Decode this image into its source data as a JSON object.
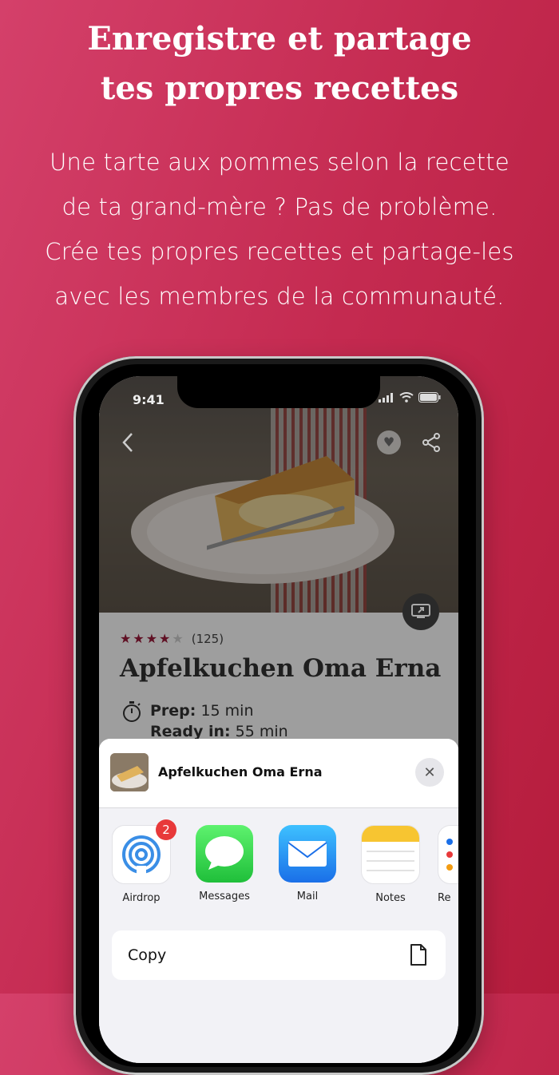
{
  "headline": {
    "line1": "Enregistre et partage",
    "line2": "tes propres recettes"
  },
  "subtext": {
    "line1": "Une tarte aux pommes selon la recette",
    "line2": "de ta grand-mère ? Pas de problème.",
    "line3": "Crée tes propres recettes et partage-les",
    "line4": "avec les membres de la communauté."
  },
  "status_bar": {
    "time": "9:41"
  },
  "recipe": {
    "rating_count": "(125)",
    "rating": 4,
    "rating_max": 5,
    "title": "Apfelkuchen Oma Erna",
    "prep_label": "Prep:",
    "prep_value": "15 min",
    "ready_label": "Ready in:",
    "ready_value": "55 min"
  },
  "share_sheet": {
    "title": "Apfelkuchen Oma Erna",
    "apps": [
      {
        "label": "Airdrop",
        "badge": "2"
      },
      {
        "label": "Messages"
      },
      {
        "label": "Mail"
      },
      {
        "label": "Notes"
      },
      {
        "label": "Re"
      }
    ],
    "copy_label": "Copy"
  },
  "colors": {
    "accent": "#c42a50",
    "star": "#9b1b3a"
  }
}
